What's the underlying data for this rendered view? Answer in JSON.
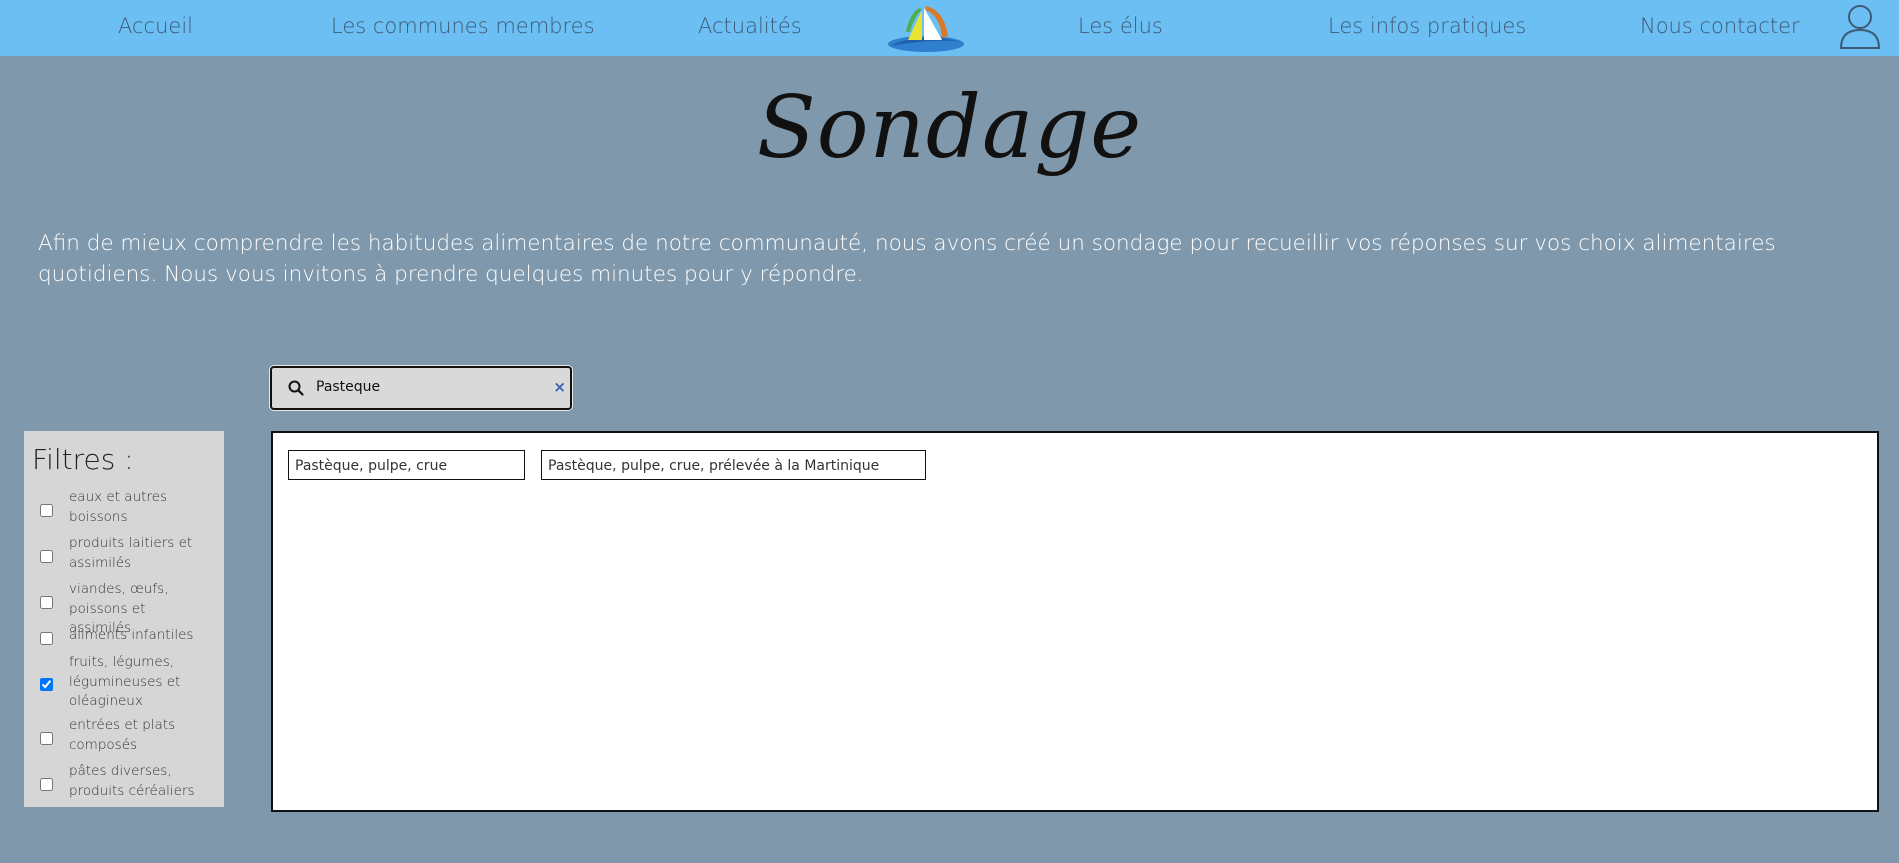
{
  "nav": {
    "items": [
      "Accueil",
      "Les communes membres",
      "Actualités",
      "Les élus",
      "Les infos pratiques",
      "Nous contacter"
    ],
    "logo_icon": "sailboat-logo",
    "user_icon": "user-icon"
  },
  "page": {
    "title": "Sondage",
    "intro": "Afin de mieux comprendre les habitudes alimentaires de notre communauté, nous avons créé un sondage pour recueillir vos réponses sur vos choix alimentaires quotidiens. Nous vous invitons à prendre quelques minutes pour y répondre."
  },
  "search": {
    "value": "Pasteque",
    "clear_symbol": "×"
  },
  "filters": {
    "title": "Filtres :",
    "items": [
      {
        "label": "eaux et autres boissons",
        "checked": false
      },
      {
        "label": "produits laitiers et assimilés",
        "checked": false
      },
      {
        "label": "viandes, œufs, poissons et assimilés",
        "checked": false
      },
      {
        "label": "aliments infantiles",
        "checked": false
      },
      {
        "label": "fruits, légumes, légumineuses et oléagineux",
        "checked": true
      },
      {
        "label": "entrées et plats composés",
        "checked": false
      },
      {
        "label": "pâtes diverses, produits céréaliers",
        "checked": false
      }
    ]
  },
  "results": {
    "items": [
      "Pastèque, pulpe, crue",
      "Pastèque, pulpe, crue, prélevée à la Martinique"
    ]
  },
  "colors": {
    "navbar": "#6bbff2",
    "background": "#7f98ab",
    "nav_text": "#3d5a78"
  }
}
